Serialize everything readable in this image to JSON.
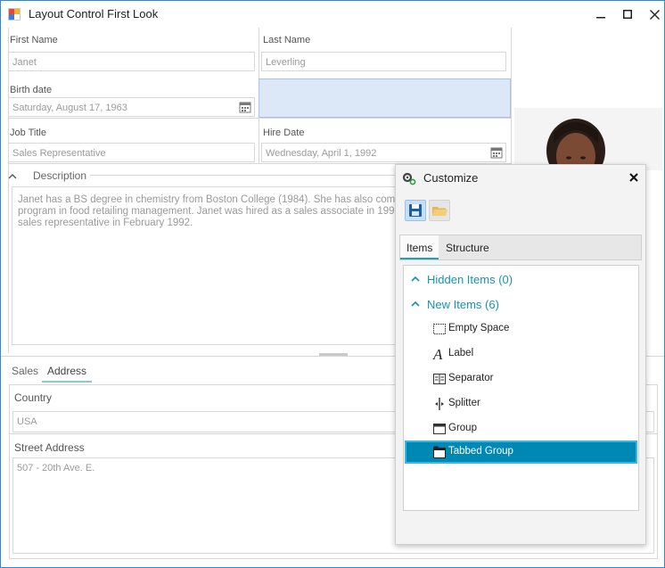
{
  "window": {
    "title": "Layout Control First Look"
  },
  "form": {
    "first_name": {
      "label": "First Name",
      "value": "Janet"
    },
    "last_name": {
      "label": "Last Name",
      "value": "Leverling"
    },
    "birth_date": {
      "label": "Birth date",
      "value": "Saturday, August 17, 1963"
    },
    "job_title": {
      "label": "Job Title",
      "value": "Sales Representative"
    },
    "hire_date": {
      "label": "Hire Date",
      "value": "Wednesday, April 1, 1992"
    },
    "description": {
      "label": "Description",
      "lines": [
        "Janet has a BS degree in chemistry from Boston College (1984).  She has also comp",
        "program in food retailing management.  Janet was hired as a sales associate in 199",
        "sales representative in February 1992."
      ]
    }
  },
  "tabs": [
    "Sales",
    "Address"
  ],
  "active_tab": "Address",
  "address": {
    "country": {
      "label": "Country",
      "value": "USA"
    },
    "street": {
      "label": "Street Address",
      "value": "507 - 20th Ave. E."
    }
  },
  "customize": {
    "title": "Customize",
    "tabs": [
      "Items",
      "Structure"
    ],
    "active_tab": "Items",
    "groups": [
      {
        "label": "Hidden Items (0)"
      },
      {
        "label": "New Items (6)"
      }
    ],
    "items": [
      {
        "label": "Empty Space",
        "icon": "empty-space-icon"
      },
      {
        "label": "Label",
        "icon": "label-icon"
      },
      {
        "label": "Separator",
        "icon": "separator-icon"
      },
      {
        "label": "Splitter",
        "icon": "splitter-icon"
      },
      {
        "label": "Group",
        "icon": "group-icon"
      },
      {
        "label": "Tabbed Group",
        "icon": "tabbed-group-icon"
      }
    ],
    "selected_item": "Tabbed Group"
  },
  "colors": {
    "accent": "#1592b8",
    "selected_row": "#0088b4",
    "selected_cell": "#dce7f7",
    "window_border": "#2b8ad6"
  }
}
